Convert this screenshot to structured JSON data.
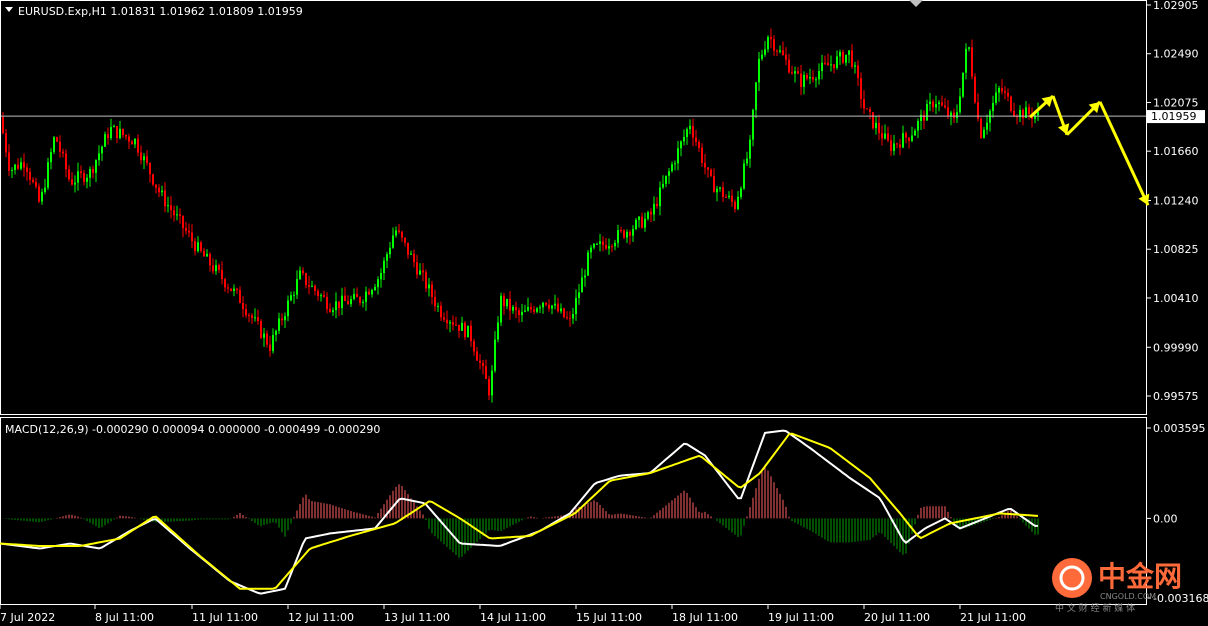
{
  "main_chart": {
    "symbol_line": "EURUSD.Exp,H1  1.01831 1.01962 1.01809 1.01959",
    "current_price_label": "1.01959",
    "current_price": 1.01959,
    "price_ticks": [
      "1.02905",
      "1.02490",
      "1.02075",
      "1.01660",
      "1.01240",
      "1.00825",
      "1.00410",
      "0.99990",
      "0.99575"
    ]
  },
  "macd_panel": {
    "label": "MACD(12,26,9) -0.000290 0.000094 0.000000 -0.000499 -0.000290",
    "ticks": [
      "0.003595",
      "0.00",
      "-0.003168"
    ]
  },
  "time_axis": {
    "labels": [
      "7 Jul 2022",
      "8 Jul 11:00",
      "11 Jul 11:00",
      "12 Jul 11:00",
      "13 Jul 11:00",
      "14 Jul 11:00",
      "15 Jul 11:00",
      "18 Jul 11:00",
      "19 Jul 11:00",
      "20 Jul 11:00",
      "21 Jul 11:00"
    ]
  },
  "watermark": {
    "brand": "中金网",
    "sub": "CNGOLD.COM",
    "cn_sub": "中 文 财 经 新 媒 体"
  },
  "colors": {
    "background": "#000000",
    "bull": "#00ff00",
    "bear": "#ff0000",
    "macd_line": "#ffffff",
    "signal_line": "#ffff00",
    "hist_pos": "#ff6060",
    "hist_neg": "#00a000",
    "forecast": "#ffff00",
    "border": "#ffffff"
  },
  "chart_data": {
    "type": "candlestick",
    "instrument": "EURUSD.Exp",
    "timeframe": "H1",
    "ylim": [
      0.995,
      1.0295
    ],
    "price_keypoints": [
      [
        0,
        1.0195
      ],
      [
        10,
        1.015
      ],
      [
        25,
        1.0158
      ],
      [
        40,
        1.012
      ],
      [
        55,
        1.018
      ],
      [
        70,
        1.014
      ],
      [
        90,
        1.0148
      ],
      [
        110,
        1.0185
      ],
      [
        135,
        1.0175
      ],
      [
        160,
        1.013
      ],
      [
        200,
        1.008
      ],
      [
        240,
        1.004
      ],
      [
        270,
        1.0
      ],
      [
        300,
        1.006
      ],
      [
        330,
        1.0035
      ],
      [
        360,
        1.004
      ],
      [
        380,
        1.006
      ],
      [
        395,
        1.01
      ],
      [
        415,
        1.007
      ],
      [
        440,
        1.003
      ],
      [
        470,
        1.001
      ],
      [
        490,
        0.996
      ],
      [
        500,
        1.004
      ],
      [
        520,
        1.0025
      ],
      [
        545,
        1.004
      ],
      [
        570,
        1.002
      ],
      [
        590,
        1.008
      ],
      [
        620,
        1.0095
      ],
      [
        650,
        1.011
      ],
      [
        665,
        1.014
      ],
      [
        690,
        1.019
      ],
      [
        710,
        1.014
      ],
      [
        735,
        1.012
      ],
      [
        750,
        1.017
      ],
      [
        758,
        1.024
      ],
      [
        768,
        1.0265
      ],
      [
        800,
        1.0225
      ],
      [
        830,
        1.024
      ],
      [
        850,
        1.025
      ],
      [
        865,
        1.02
      ],
      [
        890,
        1.017
      ],
      [
        910,
        1.018
      ],
      [
        935,
        1.021
      ],
      [
        955,
        1.019
      ],
      [
        968,
        1.026
      ],
      [
        980,
        1.018
      ],
      [
        1000,
        1.022
      ],
      [
        1015,
        1.02
      ],
      [
        1040,
        1.0196
      ]
    ],
    "macd_keypoints": [
      [
        0,
        -0.001
      ],
      [
        40,
        -0.0012
      ],
      [
        70,
        -0.001
      ],
      [
        100,
        -0.0012
      ],
      [
        130,
        -0.0005
      ],
      [
        155,
        0.0
      ],
      [
        190,
        -0.0012
      ],
      [
        230,
        -0.0025
      ],
      [
        260,
        -0.003
      ],
      [
        285,
        -0.0028
      ],
      [
        305,
        -0.0008
      ],
      [
        330,
        -0.0006
      ],
      [
        375,
        -0.0004
      ],
      [
        400,
        0.0008
      ],
      [
        425,
        0.0006
      ],
      [
        460,
        -0.001
      ],
      [
        500,
        -0.0011
      ],
      [
        540,
        -0.0005
      ],
      [
        570,
        0.0002
      ],
      [
        595,
        0.0014
      ],
      [
        620,
        0.0017
      ],
      [
        650,
        0.0018
      ],
      [
        685,
        0.003
      ],
      [
        705,
        0.0025
      ],
      [
        740,
        0.0007
      ],
      [
        765,
        0.0034
      ],
      [
        785,
        0.0035
      ],
      [
        810,
        0.0028
      ],
      [
        850,
        0.0016
      ],
      [
        880,
        0.0008
      ],
      [
        905,
        -0.001
      ],
      [
        925,
        -0.0004
      ],
      [
        945,
        0.0
      ],
      [
        960,
        -0.0004
      ],
      [
        1010,
        0.0004
      ],
      [
        1035,
        -0.0003
      ]
    ],
    "signal_keypoints": [
      [
        0,
        -0.001
      ],
      [
        40,
        -0.0011
      ],
      [
        80,
        -0.0011
      ],
      [
        120,
        -0.0008
      ],
      [
        155,
        0.0001
      ],
      [
        200,
        -0.0015
      ],
      [
        240,
        -0.0028
      ],
      [
        275,
        -0.0028
      ],
      [
        310,
        -0.0012
      ],
      [
        350,
        -0.0007
      ],
      [
        395,
        -0.0002
      ],
      [
        430,
        0.0007
      ],
      [
        460,
        0.0
      ],
      [
        490,
        -0.0008
      ],
      [
        530,
        -0.0007
      ],
      [
        575,
        0.0002
      ],
      [
        610,
        0.0015
      ],
      [
        650,
        0.0018
      ],
      [
        700,
        0.0025
      ],
      [
        740,
        0.0012
      ],
      [
        760,
        0.0018
      ],
      [
        790,
        0.0034
      ],
      [
        830,
        0.0028
      ],
      [
        870,
        0.0016
      ],
      [
        900,
        0.0002
      ],
      [
        920,
        -0.0008
      ],
      [
        950,
        -0.0002
      ],
      [
        1000,
        0.0002
      ],
      [
        1038,
        0.0001
      ]
    ],
    "forecast_path": [
      [
        1030,
        1.0195
      ],
      [
        1053,
        1.0213
      ],
      [
        1067,
        1.018
      ],
      [
        1100,
        1.0208
      ],
      [
        1148,
        1.012
      ]
    ]
  }
}
